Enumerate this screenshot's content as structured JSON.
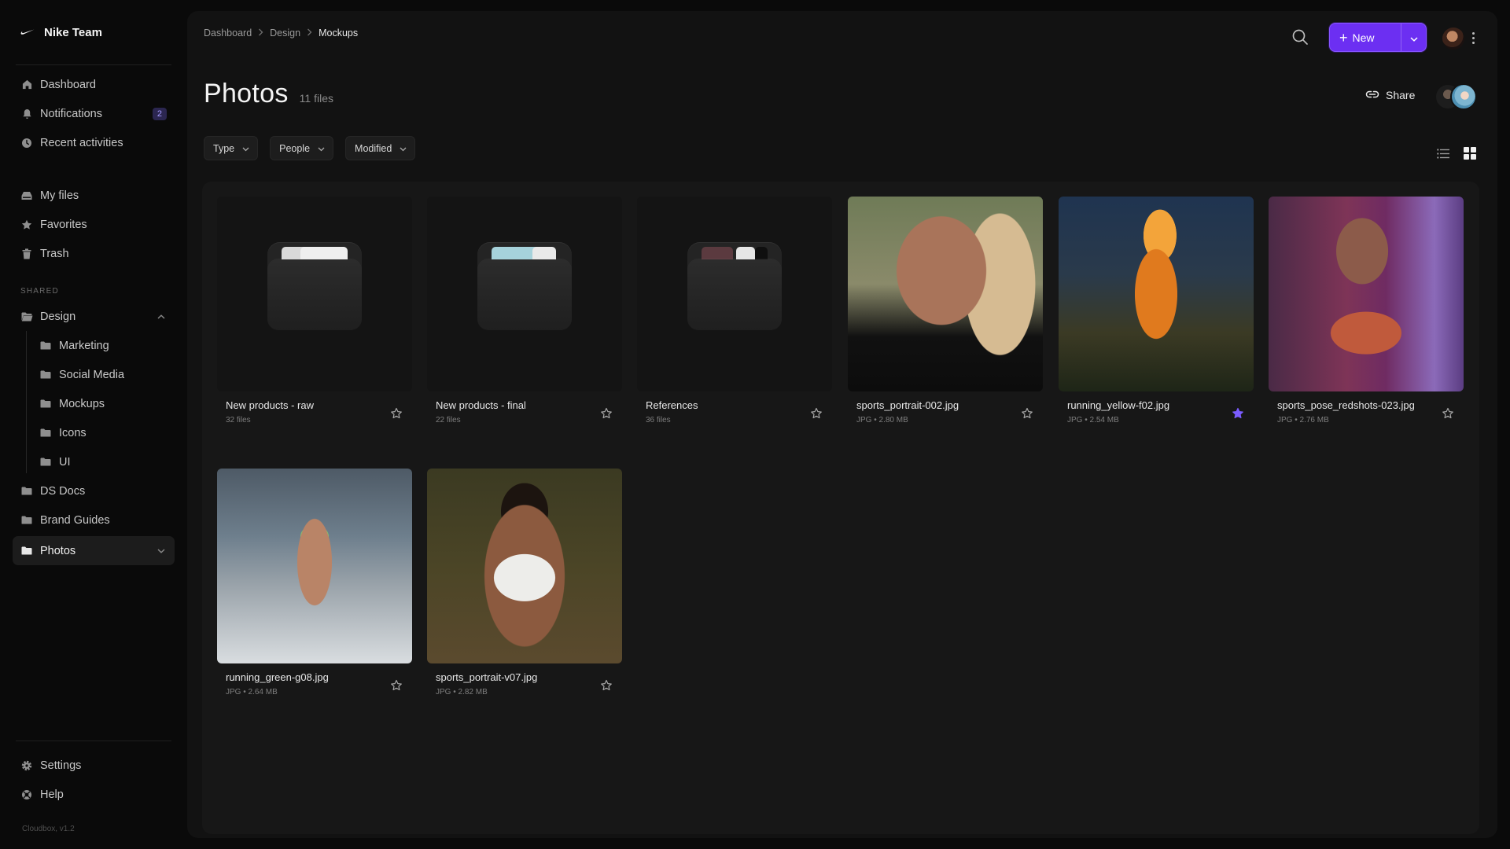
{
  "sidebar": {
    "brand": "Nike Team",
    "primary": [
      {
        "label": "Dashboard",
        "icon": "home-icon"
      },
      {
        "label": "Notifications",
        "icon": "bell-icon",
        "badge": "2"
      },
      {
        "label": "Recent activities",
        "icon": "clock-icon"
      }
    ],
    "files": [
      {
        "label": "My files",
        "icon": "drive-icon"
      },
      {
        "label": "Favorites",
        "icon": "star-icon"
      },
      {
        "label": "Trash",
        "icon": "trash-icon"
      }
    ],
    "shared_label": "SHARED",
    "design": {
      "label": "Design",
      "expanded": true,
      "children": [
        "Marketing",
        "Social Media",
        "Mockups",
        "Icons",
        "UI"
      ]
    },
    "folders": [
      "DS Docs",
      "Brand Guides"
    ],
    "active": {
      "label": "Photos"
    },
    "bottom": [
      {
        "label": "Settings",
        "icon": "gear-icon"
      },
      {
        "label": "Help",
        "icon": "lifebuoy-icon"
      }
    ],
    "version": "Cloudbox, v1.2"
  },
  "header": {
    "breadcrumb": [
      "Dashboard",
      "Design",
      "Mockups"
    ],
    "new_label": "New",
    "title": "Photos",
    "file_count": "11 files",
    "share_label": "Share"
  },
  "filters": [
    "Type",
    "People",
    "Modified"
  ],
  "view": {
    "mode": "grid"
  },
  "items": [
    {
      "name": "New products - raw",
      "meta": "32 files",
      "kind": "folder",
      "favorite": false
    },
    {
      "name": "New products - final",
      "meta": "22 files",
      "kind": "folder",
      "favorite": false
    },
    {
      "name": "References",
      "meta": "36 files",
      "kind": "folder",
      "favorite": false
    },
    {
      "name": "sports_portrait-002.jpg",
      "meta": "JPG • 2.80 MB",
      "kind": "photo",
      "favorite": false
    },
    {
      "name": "running_yellow-f02.jpg",
      "meta": "JPG • 2.54 MB",
      "kind": "photo",
      "favorite": true
    },
    {
      "name": "sports_pose_redshots-023.jpg",
      "meta": "JPG • 2.76 MB",
      "kind": "photo",
      "favorite": false
    },
    {
      "name": "running_green-g08.jpg",
      "meta": "JPG • 2.64 MB",
      "kind": "photo",
      "favorite": false
    },
    {
      "name": "sports_portrait-v07.jpg",
      "meta": "JPG • 2.82 MB",
      "kind": "photo",
      "favorite": false
    }
  ],
  "colors": {
    "accent": "#6c2ff2",
    "favorite_star": "#7b5cff",
    "background": "#0a0a0a",
    "panel": "#121212"
  }
}
